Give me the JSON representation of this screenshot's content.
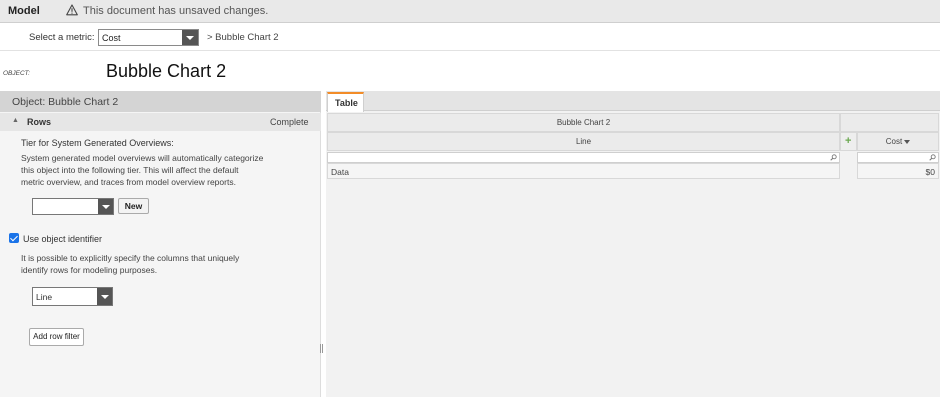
{
  "topbar": {
    "app_label": "Model",
    "warning_text": "This document has unsaved changes.",
    "warning_icon": "warning-triangle-icon"
  },
  "metricbar": {
    "label": "Select a metric:",
    "selected_metric": "Cost",
    "breadcrumb": "> Bubble Chart 2"
  },
  "object": {
    "type_label": "OBJECT:",
    "name": "Bubble Chart 2"
  },
  "leftpanel": {
    "header": "Object: Bubble Chart 2",
    "section_title": "Rows",
    "section_status": "Complete",
    "tier_heading": "Tier for System Generated Overviews:",
    "tier_description": [
      "System generated model overviews will automatically categorize",
      "this object into the following tier. This will affect the default",
      "metric overview, and traces from model overview reports."
    ],
    "tier_value": "",
    "new_button": "New",
    "use_identifier_label": "Use object identifier",
    "use_identifier_checked": true,
    "identifier_description": [
      "It is possible to explicitly specify the columns that uniquely",
      "identify rows for modeling purposes."
    ],
    "identifier_column": "Line",
    "add_row_filter": "Add row filter"
  },
  "rightpanel": {
    "tab_label": "Table",
    "accent_color": "#f28c28",
    "grid": {
      "group_header": "Bubble Chart 2",
      "dimension_column": "Line",
      "measure_column": "Cost",
      "rows": [
        {
          "dimension": "Data",
          "measure": "$0"
        }
      ]
    }
  }
}
